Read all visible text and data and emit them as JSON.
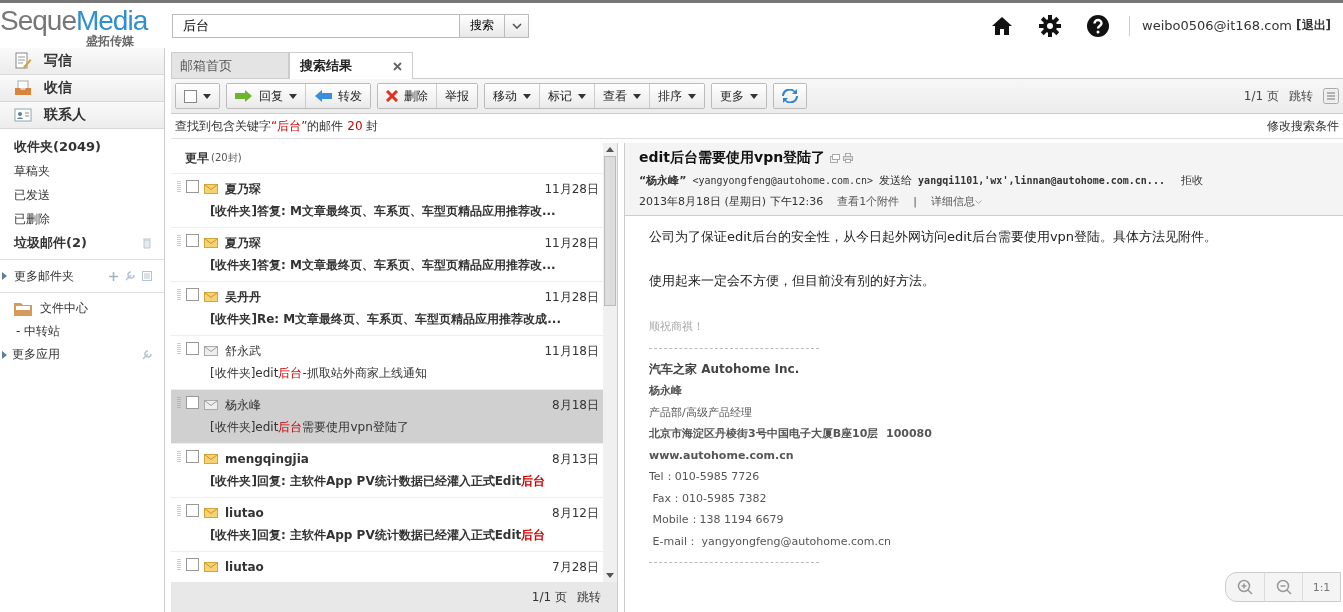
{
  "header": {
    "logo_main": "Seque",
    "logo_accent": "Media",
    "logo_sub": "盛拓传媒",
    "search": {
      "value": "后台",
      "button": "搜索"
    },
    "user": "weibo0506@it168.com",
    "logout": "[退出]"
  },
  "sidebar": {
    "actions": [
      {
        "label": "写信",
        "kind": "compose"
      },
      {
        "label": "收信",
        "kind": "inbox"
      },
      {
        "label": "联系人",
        "kind": "contacts"
      }
    ],
    "folders": [
      {
        "label": "收件夹(2049)",
        "unread": true,
        "kind": "folder"
      },
      {
        "label": "草稿夹",
        "unread": false,
        "kind": "folder"
      },
      {
        "label": "已发送",
        "unread": false,
        "kind": "folder"
      },
      {
        "label": "已删除",
        "unread": false,
        "kind": "folder"
      },
      {
        "label": "垃圾邮件(2)",
        "unread": true,
        "kind": "spam"
      }
    ],
    "more_folders": "更多邮件夹",
    "file_center": "文件中心",
    "transfer": "- 中转站",
    "more_apps": "更多应用"
  },
  "tabs": [
    {
      "label": "邮箱首页",
      "selected": false,
      "closable": false
    },
    {
      "label": "搜索结果",
      "selected": true,
      "closable": true
    }
  ],
  "toolbar": [
    [
      {
        "kind": "select"
      }
    ],
    [
      {
        "kind": "reply",
        "label": "回复"
      },
      {
        "kind": "forward",
        "label": "转发"
      }
    ],
    [
      {
        "kind": "delete",
        "label": "删除"
      },
      {
        "kind": "plain",
        "label": "举报"
      }
    ],
    [
      {
        "kind": "menu",
        "label": "移动"
      },
      {
        "kind": "menu",
        "label": "标记"
      },
      {
        "kind": "menu",
        "label": "查看"
      },
      {
        "kind": "menu",
        "label": "排序"
      }
    ],
    [
      {
        "kind": "menu",
        "label": "更多"
      }
    ],
    [
      {
        "kind": "refresh"
      }
    ]
  ],
  "pager": {
    "page": "1/1 页",
    "jump": "跳转"
  },
  "result_info": [
    {
      "text": "查找到包含关键字",
      "hit": false
    },
    {
      "text": "“后台”",
      "hit": true
    },
    {
      "text": "的邮件 ",
      "hit": false
    },
    {
      "text": "20",
      "hit": true
    },
    {
      "text": " 封",
      "hit": false
    }
  ],
  "modify_search": "修改搜索条件",
  "list": {
    "group": "更早",
    "group_count": "(20封)",
    "footer_page": "1/1 页",
    "footer_jump": "跳转",
    "rows": [
      {
        "sender": "夏乃琛",
        "date": "11月28日",
        "unread": true,
        "selected": false,
        "checked": false,
        "subject": [
          {
            "text": "[收件夹]答复: M文章最终页、车系页、车型页精品应用推荐改...",
            "hit": false
          }
        ]
      },
      {
        "sender": "夏乃琛",
        "date": "11月28日",
        "unread": true,
        "selected": false,
        "checked": false,
        "subject": [
          {
            "text": "[收件夹]答复: M文章最终页、车系页、车型页精品应用推荐改...",
            "hit": false
          }
        ]
      },
      {
        "sender": "吴丹丹",
        "date": "11月28日",
        "unread": true,
        "selected": false,
        "checked": false,
        "subject": [
          {
            "text": "[收件夹]Re: M文章最终页、车系页、车型页精品应用推荐改成...",
            "hit": false
          }
        ]
      },
      {
        "sender": "舒永武",
        "date": "11月18日",
        "unread": false,
        "selected": false,
        "checked": false,
        "subject": [
          {
            "text": "[收件夹]edit",
            "hit": false
          },
          {
            "text": "后台",
            "hit": true
          },
          {
            "text": "-抓取站外商家上线通知",
            "hit": false
          }
        ]
      },
      {
        "sender": "杨永峰",
        "date": "8月18日",
        "unread": false,
        "selected": true,
        "checked": false,
        "subject": [
          {
            "text": "[收件夹]edit",
            "hit": false
          },
          {
            "text": "后台",
            "hit": true
          },
          {
            "text": "需要使用vpn登陆了",
            "hit": false
          }
        ]
      },
      {
        "sender": "mengqingjia",
        "date": "8月13日",
        "unread": true,
        "selected": false,
        "checked": false,
        "subject": [
          {
            "text": "[收件夹]回复: 主软件App PV统计数据已经灌入正式Edit",
            "hit": false
          },
          {
            "text": "后台",
            "hit": true
          }
        ]
      },
      {
        "sender": "liutao",
        "date": "8月12日",
        "unread": true,
        "selected": false,
        "checked": false,
        "subject": [
          {
            "text": "[收件夹]回复: 主软件App PV统计数据已经灌入正式Edit",
            "hit": false
          },
          {
            "text": "后台",
            "hit": true
          }
        ]
      },
      {
        "sender": "liutao",
        "date": "7月28日",
        "unread": true,
        "selected": false,
        "checked": false,
        "subject": []
      }
    ]
  },
  "message": {
    "title": "edit后台需要使用vpn登陆了",
    "from_name": "“杨永峰”",
    "from_addr": "<yangyongfeng@autohome.com.cn>",
    "sent_to": "发送给",
    "to": "yangqi1101,'wx',linnan@autohome.com.cn...",
    "reject": "拒收",
    "date": "2013年8月18日 (星期日) 下午12:36",
    "attachment": "查看1个附件",
    "separator": "|",
    "details": "详细信息",
    "body": [
      "公司为了保证edit后台的安全性，从今日起外网访问edit后台需要使用vpn登陆。具体方法见附件。",
      "使用起来一定会不方便，但目前没有别的好方法。"
    ],
    "signature": [
      {
        "kind": "greeting",
        "text": "顺祝商祺！"
      },
      {
        "kind": "rule"
      },
      {
        "kind": "company",
        "text": "汽车之家 Autohome Inc."
      },
      {
        "kind": "bold",
        "text": "杨永峰"
      },
      {
        "kind": "plain",
        "text": "产品部/高级产品经理"
      },
      {
        "kind": "bold",
        "text": "北京市海淀区丹棱街3号中国电子大厦B座10层  100080"
      },
      {
        "kind": "bold",
        "text": "www.autohome.com.cn"
      },
      {
        "kind": "plain",
        "text": "Tel：010-5985 7726"
      },
      {
        "kind": "plain",
        "text": " Fax：010-5985 7382"
      },
      {
        "kind": "plain",
        "text": " Mobile：138 1194 6679"
      },
      {
        "kind": "plain",
        "text": " E-mail： yangyongfeng@autohome.com.cn"
      },
      {
        "kind": "rule"
      }
    ],
    "zoom_reset": "1:1"
  }
}
